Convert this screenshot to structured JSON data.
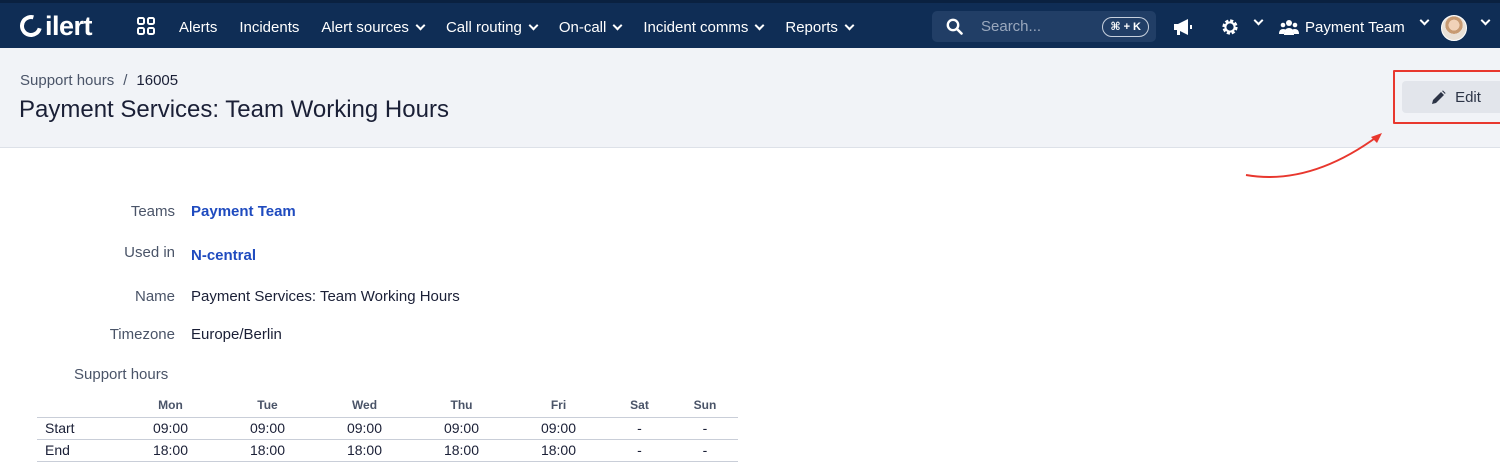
{
  "brand": {
    "name": "ilert"
  },
  "nav": {
    "items": [
      {
        "label": "Alerts",
        "dropdown": false
      },
      {
        "label": "Incidents",
        "dropdown": false
      },
      {
        "label": "Alert sources",
        "dropdown": true
      },
      {
        "label": "Call routing",
        "dropdown": true
      },
      {
        "label": "On-call",
        "dropdown": true
      },
      {
        "label": "Incident comms",
        "dropdown": true
      },
      {
        "label": "Reports",
        "dropdown": true
      }
    ],
    "search_placeholder": "Search...",
    "search_shortcut": "⌘ + K",
    "team_label": "Payment Team"
  },
  "header": {
    "breadcrumb_parent": "Support hours",
    "breadcrumb_sep": "/",
    "breadcrumb_current": "16005",
    "title": "Payment Services: Team Working Hours",
    "edit_label": "Edit"
  },
  "details": {
    "teams_label": "Teams",
    "teams_value": "Payment Team",
    "used_in_label": "Used in",
    "used_in_value": "N-central",
    "name_label": "Name",
    "name_value": "Payment Services: Team Working Hours",
    "timezone_label": "Timezone",
    "timezone_value": "Europe/Berlin",
    "support_hours_label": "Support hours"
  },
  "hours_table": {
    "days": [
      "Mon",
      "Tue",
      "Wed",
      "Thu",
      "Fri",
      "Sat",
      "Sun"
    ],
    "rows": [
      {
        "label": "Start",
        "values": [
          "09:00",
          "09:00",
          "09:00",
          "09:00",
          "09:00",
          "-",
          "-"
        ]
      },
      {
        "label": "End",
        "values": [
          "18:00",
          "18:00",
          "18:00",
          "18:00",
          "18:00",
          "-",
          "-"
        ]
      }
    ]
  },
  "colors": {
    "navbar": "#0f2d55",
    "link": "#1f4bbf",
    "highlight": "#e8372e",
    "header_bg": "#f1f3f7"
  }
}
